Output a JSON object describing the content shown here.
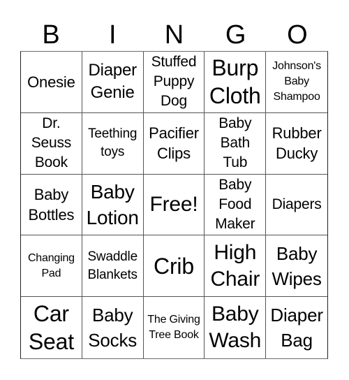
{
  "header": {
    "letters": [
      "B",
      "I",
      "N",
      "G",
      "O"
    ]
  },
  "board": {
    "rows": [
      [
        "Onesie",
        "Diaper Genie",
        "Stuffed Puppy Dog",
        "Burp Cloth",
        "Johnson's Baby Shampoo"
      ],
      [
        "Dr. Seuss Book",
        "Teething toys",
        "Pacifier Clips",
        "Baby Bath Tub",
        "Rubber Ducky"
      ],
      [
        "Baby Bottles",
        "Baby Lotion",
        "Free!",
        "Baby Food Maker",
        "Diapers"
      ],
      [
        "Changing Pad",
        "Swaddle Blankets",
        "Crib",
        "High Chair",
        "Baby Wipes"
      ],
      [
        "Car Seat",
        "Baby Socks",
        "The Giving Tree Book",
        "Baby Wash",
        "Diaper Bag"
      ]
    ],
    "free_space": "Free!"
  }
}
